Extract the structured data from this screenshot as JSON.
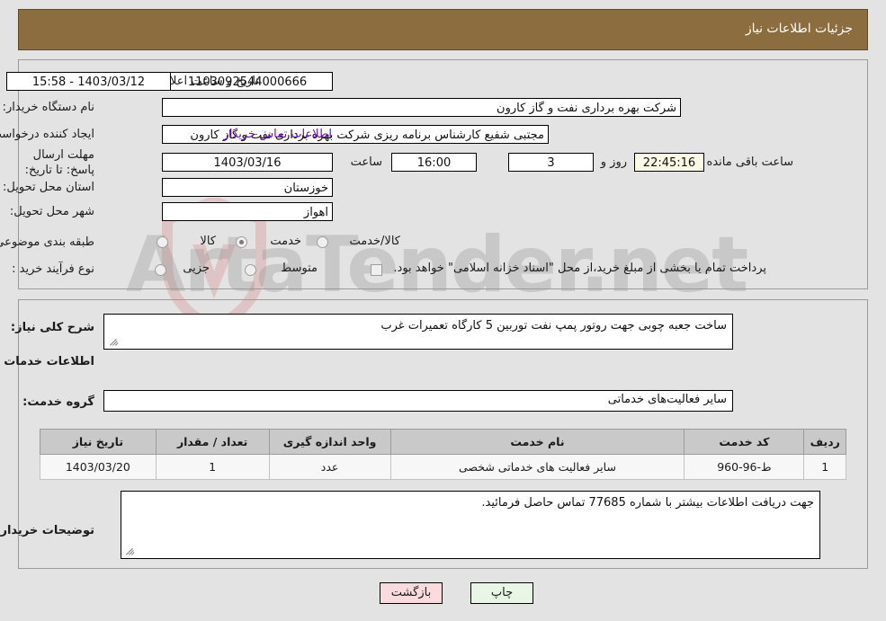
{
  "header": {
    "title": "جزئیات اطلاعات نیاز",
    "bar_color": "#8b6d3f"
  },
  "form": {
    "need_number_label": "شماره نیاز:",
    "need_number_value": "1103092544000666",
    "announce_datetime_label": "تاریخ و ساعت اعلان عمومی:",
    "announce_datetime_value": "1403/03/12 - 15:58",
    "buyer_org_label": "نام دستگاه خریدار:",
    "buyer_org_value": "شرکت بهره برداری نفت و گاز کارون",
    "requester_label": "ایجاد کننده درخواست:",
    "requester_value": "مجتبی شفیع کارشناس برنامه ریزی شرکت بهره برداری نفت و گاز کارون",
    "buyer_contact_link": "اطلاعات تماس خریدار",
    "deadline_label": "مهلت ارسال پاسخ: تا تاریخ:",
    "deadline_date_value": "1403/03/16",
    "hour_label": "ساعت",
    "hour_value": "16:00",
    "days_value": "3",
    "days_and_label": "روز و",
    "countdown_value": "22:45:16",
    "remaining_label": "ساعت باقی مانده",
    "province_label": "استان محل تحویل:",
    "province_value": "خوزستان",
    "city_label": "شهر محل تحویل:",
    "city_value": "اهواز",
    "category_label": "طبقه بندی موضوعی:",
    "category_options": [
      {
        "label": "کالا",
        "selected": false
      },
      {
        "label": "خدمت",
        "selected": true
      },
      {
        "label": "کالا/خدمت",
        "selected": false
      }
    ],
    "process_label": "نوع فرآیند خرید :",
    "process_options": [
      {
        "label": "جزیی",
        "selected": false
      },
      {
        "label": "متوسط",
        "selected": false
      }
    ],
    "treasury_checkbox_label": "پرداخت تمام یا بخشی از مبلغ خرید،از محل \"اسناد خزانه اسلامی\" خواهد بود.",
    "treasury_checked": false
  },
  "description": {
    "general_need_label": "شرح کلی نیاز:",
    "general_need_value": "ساخت جعبه چوبی جهت روتور پمپ نفت توربین 5 کارگاه تعمیرات غرب",
    "services_heading": "اطلاعات خدمات مورد نیاز",
    "service_group_label": "گروه خدمت:",
    "service_group_value": "سایر فعالیت‌های خدماتی"
  },
  "table": {
    "headers": [
      "ردیف",
      "کد خدمت",
      "نام خدمت",
      "واحد اندازه گیری",
      "تعداد / مقدار",
      "تاریخ نیاز"
    ],
    "rows": [
      {
        "row_no": "1",
        "service_code": "ط-96-960",
        "service_name": "سایر فعالیت های خدماتی شخصی",
        "unit": "عدد",
        "quantity": "1",
        "need_date": "1403/03/20"
      }
    ]
  },
  "buyer_notes": {
    "label": "توضیحات خریدار:",
    "value": "جهت دریافت اطلاعات بیشتر با شماره 77685 تماس حاصل فرمائید."
  },
  "buttons": {
    "print_label": "چاپ",
    "back_label": "بازگشت"
  },
  "watermark": {
    "text": "ArtaTender.net"
  }
}
